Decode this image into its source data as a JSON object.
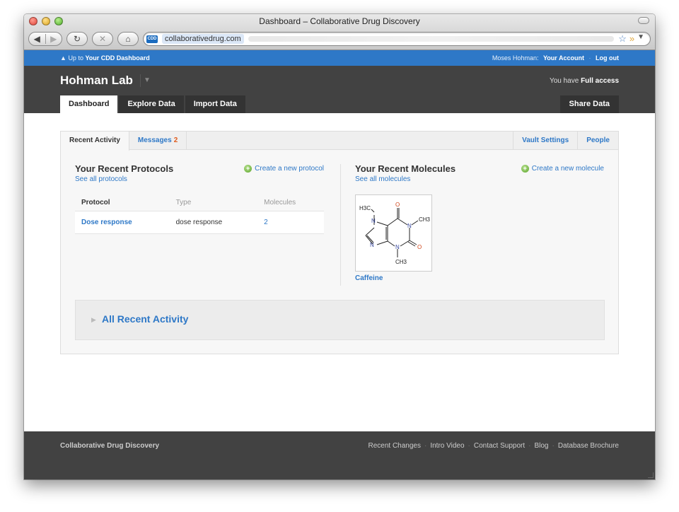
{
  "window": {
    "title": "Dashboard – Collaborative Drug Discovery"
  },
  "toolbar": {
    "domain": "collaborativedrug.com",
    "favicon_label": "CDD"
  },
  "topbar": {
    "up_prefix": "Up to",
    "up_link": "Your CDD Dashboard",
    "user_name": "Moses Hohman:",
    "account_link": "Your Account",
    "logout_link": "Log out"
  },
  "header": {
    "lab_name": "Hohman Lab",
    "access_prefix": "You have",
    "access_level": "Full access"
  },
  "main_tabs": [
    {
      "label": "Dashboard"
    },
    {
      "label": "Explore Data"
    },
    {
      "label": "Import Data"
    }
  ],
  "share_button": "Share Data",
  "sub_tabs": {
    "recent_activity": "Recent Activity",
    "messages": "Messages",
    "messages_count": "2",
    "vault_settings": "Vault Settings",
    "people": "People"
  },
  "protocols": {
    "title": "Your Recent Protocols",
    "see_all": "See all protocols",
    "create": "Create a new protocol",
    "columns": [
      "Protocol",
      "Type",
      "Molecules"
    ],
    "rows": [
      {
        "protocol": "Dose response",
        "type": "dose response",
        "molecules": "2"
      }
    ]
  },
  "molecules": {
    "title": "Your Recent Molecules",
    "see_all": "See all molecules",
    "create": "Create a new molecule",
    "items": [
      {
        "name": "Caffeine",
        "atoms": {
          "methyl": "H3C",
          "o1": "O",
          "o2": "O",
          "n": "N",
          "ch3a": "CH3",
          "ch3b": "CH3"
        }
      }
    ]
  },
  "activity": {
    "label": "All Recent Activity"
  },
  "footer": {
    "brand": "Collaborative Drug Discovery",
    "links": [
      "Recent Changes",
      "Intro Video",
      "Contact Support",
      "Blog",
      "Database Brochure"
    ],
    "separator": "·"
  },
  "colors": {
    "brand_blue": "#2e78c7",
    "dark_header": "#424242",
    "alert_orange": "#e05a1c",
    "atom_nitrogen": "#3a4aa0",
    "atom_oxygen": "#d0451b"
  }
}
